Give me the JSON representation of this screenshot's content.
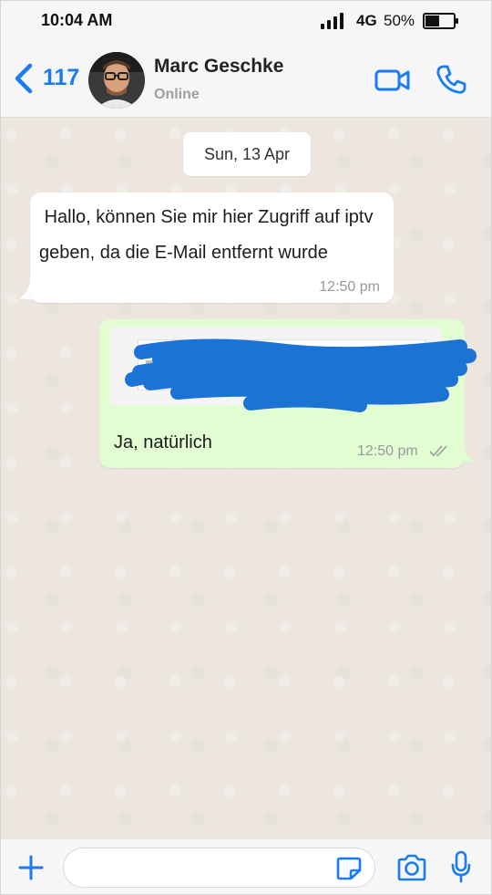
{
  "status_bar": {
    "time": "10:04 AM",
    "network": "4G",
    "battery": "50%",
    "battery_level": 0.5,
    "icons": [
      "signal-icon",
      "battery-icon"
    ]
  },
  "header": {
    "back_count": "117",
    "contact_name": "Marc Geschke",
    "contact_status": "Online",
    "icons": [
      "back-chevron-icon",
      "avatar",
      "video-call-icon",
      "phone-call-icon"
    ]
  },
  "chat": {
    "date": "Sun, 13 Apr",
    "messages": [
      {
        "direction": "incoming",
        "text": " Hallo, können Sie mir hier Zugriff auf iptv geben, da die E-Mail entfernt wurde",
        "time": "12:50 pm"
      },
      {
        "direction": "outgoing",
        "attachment": "redacted-image",
        "text": "Ja, natürlich",
        "time": "12:50 pm",
        "status": "read-double-tick"
      }
    ]
  },
  "input_bar": {
    "placeholder": "",
    "icons": [
      "plus-icon",
      "sticker-icon",
      "camera-icon",
      "microphone-icon"
    ]
  },
  "colors": {
    "accent": "#1a7bf2",
    "incoming_bubble": "#ffffff",
    "outgoing_bubble": "#e2fdd2",
    "chat_background": "#ece6df",
    "redaction": "#1b73d6"
  }
}
